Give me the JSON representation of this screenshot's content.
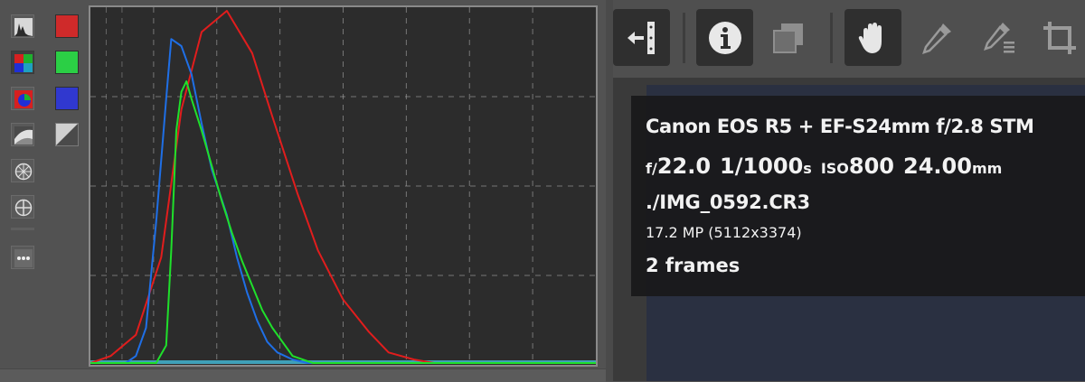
{
  "histogram": {
    "modes": [
      {
        "name": "histogram-mode-icon",
        "active": false
      },
      {
        "name": "rgb-parade-mode-icon",
        "active": true
      },
      {
        "name": "channel-overlay-mode-icon",
        "active": false
      },
      {
        "name": "curve-mode-icon",
        "active": false
      },
      {
        "name": "scope-mode-icon",
        "active": false
      },
      {
        "name": "crosshair-mode-icon",
        "active": false
      },
      {
        "name": "more-options-icon",
        "active": false
      }
    ],
    "channel_toggles": [
      {
        "name": "red-channel-toggle",
        "color": "#cf2a2a"
      },
      {
        "name": "green-channel-toggle",
        "color": "#2bcf45"
      },
      {
        "name": "blue-channel-toggle",
        "color": "#3038cf"
      },
      {
        "name": "luminance-toggle",
        "color": "#bdbdbd"
      }
    ],
    "series": [
      {
        "color": "#e11d1d",
        "x": [
          0,
          4,
          9,
          14,
          18,
          22,
          27,
          32,
          36,
          41,
          45,
          50,
          55,
          59,
          64,
          68,
          73,
          78,
          82,
          87,
          91,
          96,
          100
        ],
        "y": [
          0,
          0.02,
          0.08,
          0.3,
          0.72,
          0.94,
          1.0,
          0.88,
          0.7,
          0.48,
          0.32,
          0.18,
          0.09,
          0.03,
          0.01,
          0,
          0,
          0,
          0,
          0,
          0,
          0,
          0
        ]
      },
      {
        "color": "#1f6fe6",
        "x": [
          0,
          7,
          9,
          11,
          13,
          15,
          16,
          18,
          20,
          22,
          24,
          27,
          29,
          31,
          33,
          35,
          37,
          40,
          43,
          46,
          100
        ],
        "y": [
          0,
          0,
          0.02,
          0.1,
          0.4,
          0.75,
          0.92,
          0.9,
          0.82,
          0.68,
          0.55,
          0.42,
          0.3,
          0.2,
          0.12,
          0.06,
          0.03,
          0.01,
          0,
          0,
          0
        ]
      },
      {
        "color": "#1fe02b",
        "x": [
          0,
          13,
          15,
          16,
          17,
          18,
          19,
          20,
          22,
          24,
          26,
          28,
          30,
          32,
          34,
          36,
          38,
          40,
          42,
          44,
          100
        ],
        "y": [
          0,
          0,
          0.05,
          0.32,
          0.66,
          0.77,
          0.8,
          0.75,
          0.66,
          0.56,
          0.46,
          0.37,
          0.29,
          0.22,
          0.15,
          0.1,
          0.06,
          0.02,
          0.01,
          0,
          0
        ]
      }
    ],
    "grid_color": "#a8a8a8",
    "baseline_color": "#3fa0b8"
  },
  "toolbar": {
    "buttons": [
      {
        "name": "collapse-panel-icon",
        "pressed": true
      },
      {
        "name": "info-icon",
        "pressed": true
      },
      {
        "name": "compare-snapshot-icon",
        "pressed": false
      },
      {
        "name": "hand-pan-icon",
        "pressed": true
      },
      {
        "name": "color-picker-icon",
        "pressed": false
      },
      {
        "name": "color-picker-list-icon",
        "pressed": false
      },
      {
        "name": "crop-icon",
        "pressed": false
      }
    ]
  },
  "info": {
    "camera_lens": "Canon EOS R5 + EF-S24mm f/2.8 STM",
    "aperture_prefix": "f/",
    "aperture": "22.0",
    "shutter": "1/1000",
    "shutter_unit": "s",
    "iso_label": "ISO",
    "iso": "800",
    "focal": "24.00",
    "focal_unit": "mm",
    "filename": "./IMG_0592.CR3",
    "resolution": "17.2 MP (5112x3374)",
    "frames": "2 frames"
  }
}
